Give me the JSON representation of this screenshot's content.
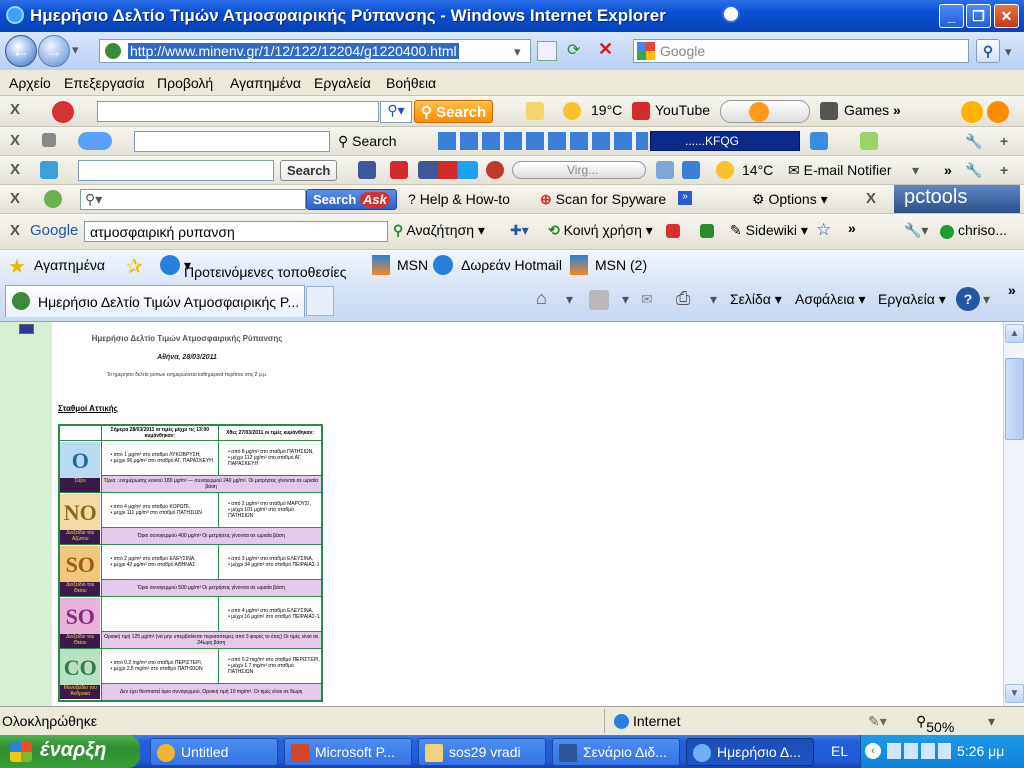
{
  "window": {
    "title": "Ημερήσιο Δελτίο Τιμών Ατμοσφαιρικής Ρύπανσης - Windows Internet Explorer"
  },
  "address": {
    "url": "http://www.minenv.gr/1/12/122/12204/g1220400.html",
    "search_placeholder": "Google"
  },
  "menu": [
    "Αρχείο",
    "Επεξεργασία",
    "Προβολή",
    "Αγαπημένα",
    "Εργαλεία",
    "Βοήθεια"
  ],
  "toolbar1": {
    "search_btn": "Search",
    "temp": "19°C",
    "youtube": "YouTube",
    "games": "Games"
  },
  "toolbar2": {
    "search_label": "Search",
    "kfqg": "......KFQG"
  },
  "toolbar3": {
    "search_btn": "Search",
    "virg": "Virg...",
    "temp": "14°C",
    "email": "E-mail Notifier"
  },
  "toolbar4": {
    "search_btn": "Search",
    "help": "Help & How-to",
    "scan": "Scan for Spyware",
    "options": "Options",
    "brand": "pctools"
  },
  "toolbar5": {
    "google": "Google",
    "query": "ατμοσφαιρική ρυπανση",
    "search": "Αναζήτηση",
    "share": "Κοινή χρήση",
    "sidewiki": "Sidewiki",
    "user": "chriso..."
  },
  "favorites": {
    "label": "Αγαπημένα",
    "items": [
      "Προτεινόμενες τοποθεσίες",
      "MSN",
      "Δωρεάν Hotmail",
      "MSN (2)"
    ]
  },
  "tab": {
    "title": "Ημερήσιο Δελτίο Τιμών Ατμοσφαιρικής Ρ..."
  },
  "commandbar": {
    "page": "Σελίδα",
    "safety": "Ασφάλεια",
    "tools": "Εργαλεία"
  },
  "page": {
    "heading": "Ημερήσιο Δελτίο Τιμών Ατμοσφαιρικής Ρύπανσης",
    "date": "Αθήνα, 28/03/2011",
    "note": "Το ημερήσιο δελτίο ρύπων ενημερώνεται καθημερινά περίπου στις 2 μ.μ.",
    "stations_link": "Σταθμοί Αττικής",
    "table": {
      "header_today": "Σήμερα 28/03/2011 οι τιμές μέχρι τις 13:00 κυμάνθηκαν:",
      "header_yesterday": "Χθες 27/03/2011 οι τιμές κυμάνθηκαν:",
      "pollutants": [
        {
          "symbol": "O",
          "name": "Όζον",
          "color": "#1e6b8f",
          "bg": "#b7dcef",
          "today": [
            "από 1 μg/m³ στο σταθμό ΛΥΚΟΒΡΥΣΗ,",
            "μέχρι 96 μg/m³ στο σταθμό ΑΓ. ΠΑΡΑΣΚΕΥΗ"
          ],
          "yesterday": [
            "από 8 μg/m³ στο σταθμό ΠΑΤΗΣΙΩΝ,",
            "μέχρι 112 μg/m³ στο σταθμό ΑΓ. ΠΑΡΑΣΚΕΥΗ"
          ],
          "limit": "Όρια : ενημέρωσης κοινού 180 μg/m³ — συναγερμού 240 μg/m³. Οι μετρήσεις γίνονται σε ωριαία βάση"
        },
        {
          "symbol": "NO",
          "name": "Διοξείδιο του Αζώτου",
          "color": "#8a6a1f",
          "bg": "#f3dca3",
          "today": [
            "από 4 μg/m³ στο σταθμό ΚΟΡΩΠΙ,",
            "μέχρι 111 μg/m³ στο σταθμό ΠΑΤΗΣΙΩΝ"
          ],
          "yesterday": [
            "από 2 μg/m³ στο σταθμό ΜΑΡΟΥΣΙ,",
            "μέχρι 101 μg/m³ στο σταθμό ΠΑΤΗΣΙΩΝ"
          ],
          "limit": "Όριο συναγερμού 400 μg/m³ Οι μετρήσεις γίνονται σε ωριαία βάση"
        },
        {
          "symbol": "SO",
          "name": "Διοξείδιο του Θείου",
          "color": "#9a5b16",
          "bg": "#f0c77d",
          "today": [
            "από 2 μg/m³ στο σταθμό ΕΛΕΥΣΙΝΑ,",
            "μέχρι 42 μg/m³ στο σταθμό ΑΘΗΝΑΣ"
          ],
          "yesterday": [
            "από 3 μg/m³ στο σταθμό ΕΛΕΥΣΙΝΑ,",
            "μέχρι 34 μg/m³ στο σταθμό ΠΕΙΡΑΙΑΣ-1"
          ],
          "limit": "Όριο συναγερμού 500 μg/m³ Οι μετρήσεις γίνονται σε ωριαία βάση"
        },
        {
          "symbol": "SO",
          "name": "Διοξείδιο του Θείου",
          "color": "#8a2a7a",
          "bg": "#e9b2d9",
          "today": [],
          "yesterday": [
            "από 4 μg/m³ στο σταθμό ΕΛΕΥΣΙΝΑ,",
            "μέχρι 16 μg/m³ στο σταθμό ΠΕΙΡΑΙΑΣ-1"
          ],
          "limit": "Οριακή τιμή 125 μg/m³ (να μην υπερβαίνεται περισσότερες από 3 φορές το έτος) Οι τιμές είναι σε 24ωρη βάση"
        },
        {
          "symbol": "CO",
          "name": "Μονοξείδιο του Άνθρακα",
          "color": "#2f7a4a",
          "bg": "#b8e0c2",
          "today": [
            "από 0.2 mg/m³ στο σταθμό ΠΕΡΙΣΤΕΡΙ,",
            "μέχρι 2.5 mg/m³ στο σταθμό ΠΑΤΗΣΙΩΝ"
          ],
          "yesterday": [
            "από 0.2 mg/m³ στο σταθμό ΠΕΡΙΣΤΕΡΙ,",
            "μέχρι 1.7 mg/m³ στο σταθμό ΠΑΤΗΣΙΩΝ"
          ],
          "limit": "Δεν έχει θεσπιστεί όριο συναγερμού. Οριακή τιμή 10 mg/m³. Οι τιμές είναι σε 8ωρη"
        }
      ]
    }
  },
  "status": {
    "text": "Ολοκληρώθηκε",
    "zone": "Internet",
    "zoom": "50%"
  },
  "taskbar": {
    "start": "έναρξη",
    "tasks": [
      "Untitled",
      "Microsoft P...",
      "sos29 vradi",
      "Σενάριο Διδ...",
      "Ημερήσιο Δ..."
    ],
    "lang": "EL",
    "clock": "5:26 μμ"
  }
}
